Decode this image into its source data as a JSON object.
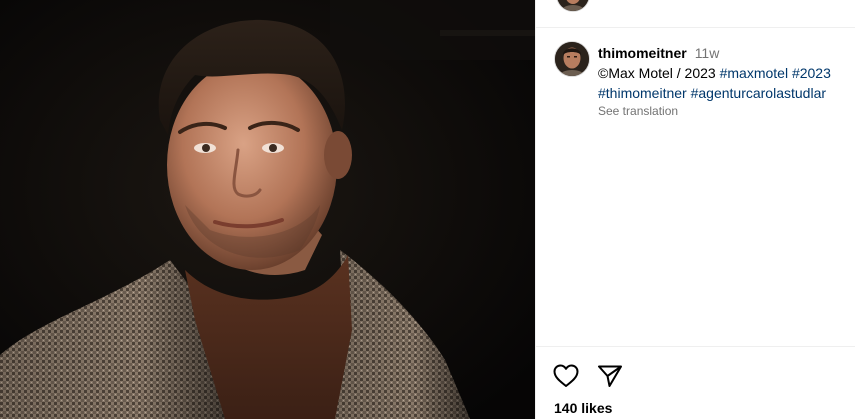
{
  "post": {
    "author": "thimomeitner",
    "time_ago": "11w",
    "caption": {
      "line1_text": "©Max Motel / 2023 ",
      "line1_tags": [
        "#maxmotel",
        "#2023"
      ],
      "line2_tags": [
        "#thimomeitner",
        "#agenturcarolastudlar"
      ]
    },
    "see_translation": "See translation",
    "likes_text": "140 likes"
  },
  "colors": {
    "hashtag": "#00376b",
    "muted": "#737373",
    "divider": "#efefef"
  },
  "icons": {
    "like": "heart-outline-icon",
    "share": "paper-plane-icon"
  }
}
